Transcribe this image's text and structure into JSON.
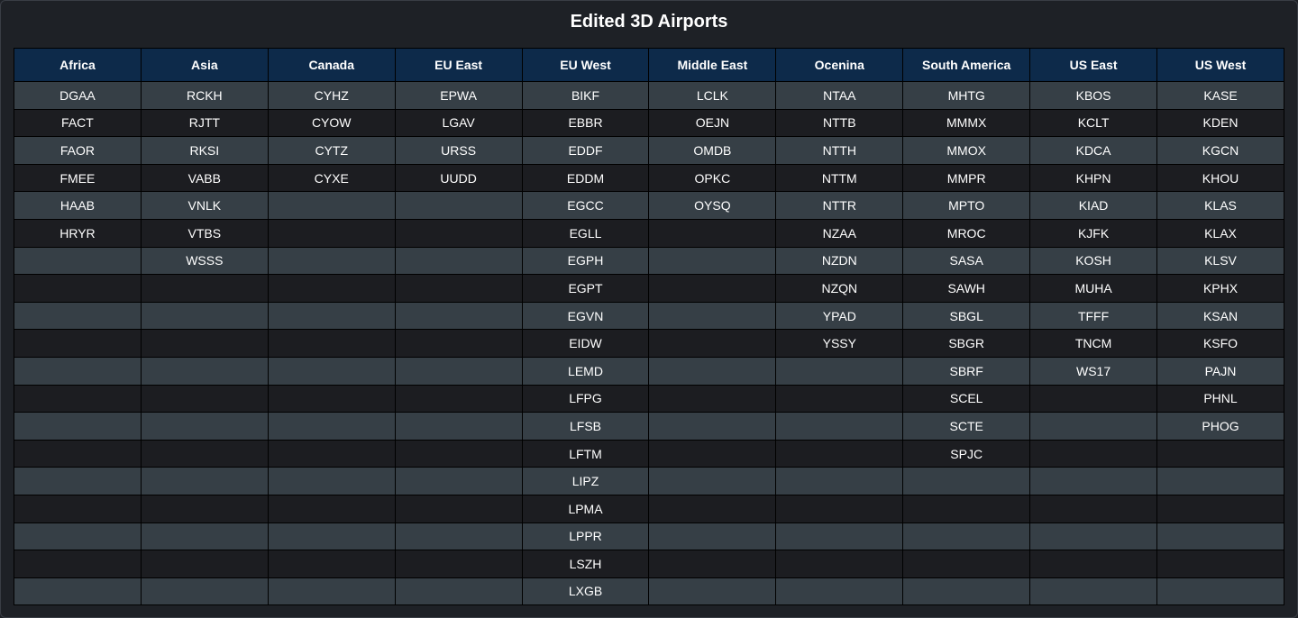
{
  "page": {
    "title": "Edited 3D Airports"
  },
  "table": {
    "headers": [
      "Africa",
      "Asia",
      "Canada",
      "EU East",
      "EU West",
      "Middle East",
      "Ocenina",
      "South America",
      "US East",
      "US West"
    ],
    "rows": [
      [
        "DGAA",
        "RCKH",
        "CYHZ",
        "EPWA",
        "BIKF",
        "LCLK",
        "NTAA",
        "MHTG",
        "KBOS",
        "KASE"
      ],
      [
        "FACT",
        "RJTT",
        "CYOW",
        "LGAV",
        "EBBR",
        "OEJN",
        "NTTB",
        "MMMX",
        "KCLT",
        "KDEN"
      ],
      [
        "FAOR",
        "RKSI",
        "CYTZ",
        "URSS",
        "EDDF",
        "OMDB",
        "NTTH",
        "MMOX",
        "KDCA",
        "KGCN"
      ],
      [
        "FMEE",
        "VABB",
        "CYXE",
        "UUDD",
        "EDDM",
        "OPKC",
        "NTTM",
        "MMPR",
        "KHPN",
        "KHOU"
      ],
      [
        "HAAB",
        "VNLK",
        "",
        "",
        "EGCC",
        "OYSQ",
        "NTTR",
        "MPTO",
        "KIAD",
        "KLAS"
      ],
      [
        "HRYR",
        "VTBS",
        "",
        "",
        "EGLL",
        "",
        "NZAA",
        "MROC",
        "KJFK",
        "KLAX"
      ],
      [
        "",
        "WSSS",
        "",
        "",
        "EGPH",
        "",
        "NZDN",
        "SASA",
        "KOSH",
        "KLSV"
      ],
      [
        "",
        "",
        "",
        "",
        "EGPT",
        "",
        "NZQN",
        "SAWH",
        "MUHA",
        "KPHX"
      ],
      [
        "",
        "",
        "",
        "",
        "EGVN",
        "",
        "YPAD",
        "SBGL",
        "TFFF",
        "KSAN"
      ],
      [
        "",
        "",
        "",
        "",
        "EIDW",
        "",
        "YSSY",
        "SBGR",
        "TNCM",
        "KSFO"
      ],
      [
        "",
        "",
        "",
        "",
        "LEMD",
        "",
        "",
        "SBRF",
        "WS17",
        "PAJN"
      ],
      [
        "",
        "",
        "",
        "",
        "LFPG",
        "",
        "",
        "SCEL",
        "",
        "PHNL"
      ],
      [
        "",
        "",
        "",
        "",
        "LFSB",
        "",
        "",
        "SCTE",
        "",
        "PHOG"
      ],
      [
        "",
        "",
        "",
        "",
        "LFTM",
        "",
        "",
        "SPJC",
        "",
        ""
      ],
      [
        "",
        "",
        "",
        "",
        "LIPZ",
        "",
        "",
        "",
        "",
        ""
      ],
      [
        "",
        "",
        "",
        "",
        "LPMA",
        "",
        "",
        "",
        "",
        ""
      ],
      [
        "",
        "",
        "",
        "",
        "LPPR",
        "",
        "",
        "",
        "",
        ""
      ],
      [
        "",
        "",
        "",
        "",
        "LSZH",
        "",
        "",
        "",
        "",
        ""
      ],
      [
        "",
        "",
        "",
        "",
        "LXGB",
        "",
        "",
        "",
        "",
        ""
      ]
    ]
  },
  "colors": {
    "page_background": "#1e2126",
    "header_background": "#0d2a4a",
    "row_odd": "#363f46",
    "row_even": "#1c1d21",
    "border": "#000000",
    "text": "#ffffff"
  }
}
